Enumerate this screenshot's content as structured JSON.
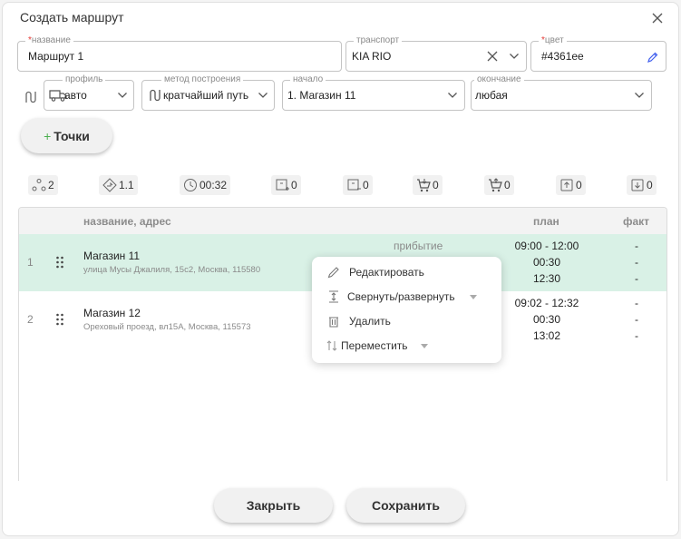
{
  "dialog": {
    "title": "Создать маршрут"
  },
  "form": {
    "name": {
      "label": "название",
      "required": "*",
      "value": "Маршрут 1"
    },
    "transport": {
      "label": "транспорт",
      "value": "KIA RIO"
    },
    "color": {
      "label": "цвет",
      "required": "*",
      "value": "#4361ee"
    },
    "profile": {
      "label": "профиль",
      "value": "авто"
    },
    "method": {
      "label": "метод построения",
      "value": "кратчайший путь"
    },
    "start": {
      "label": "начало",
      "value": "1. Магазин 11"
    },
    "end": {
      "label": "окончание",
      "value": "любая"
    }
  },
  "points_button": {
    "plus": "+",
    "label": "Точки"
  },
  "stats": [
    "2",
    "1.1",
    "00:32",
    "0",
    "0",
    "0",
    "0",
    "0",
    "0"
  ],
  "table": {
    "headers": {
      "name": "название, адрес",
      "plan": "план",
      "fact": "факт"
    },
    "rows": [
      {
        "num": "1",
        "name": "Магазин 11",
        "address": "улица Мусы Джалиля, 15с2, Москва, 115580",
        "arrival": "прибытие",
        "plan": [
          "09:00 - 12:00",
          "00:30",
          "12:30"
        ],
        "fact": [
          "-",
          "-",
          "-"
        ]
      },
      {
        "num": "2",
        "name": "Магазин 12",
        "address": "Ореховый проезд, вл15А, Москва, 115573",
        "plan": [
          "09:02 - 12:32",
          "00:30",
          "13:02"
        ],
        "fact": [
          "-",
          "-",
          "-"
        ]
      }
    ]
  },
  "context_menu": {
    "edit": "Редактировать",
    "collapse": "Свернуть/развернуть",
    "delete": "Удалить",
    "move": "Переместить"
  },
  "footer": {
    "close": "Закрыть",
    "save": "Сохранить"
  },
  "colors": {
    "accent": "#4361ee",
    "selected_row": "#d9f1e6",
    "required": "#e53935",
    "plus": "#4caf50"
  }
}
